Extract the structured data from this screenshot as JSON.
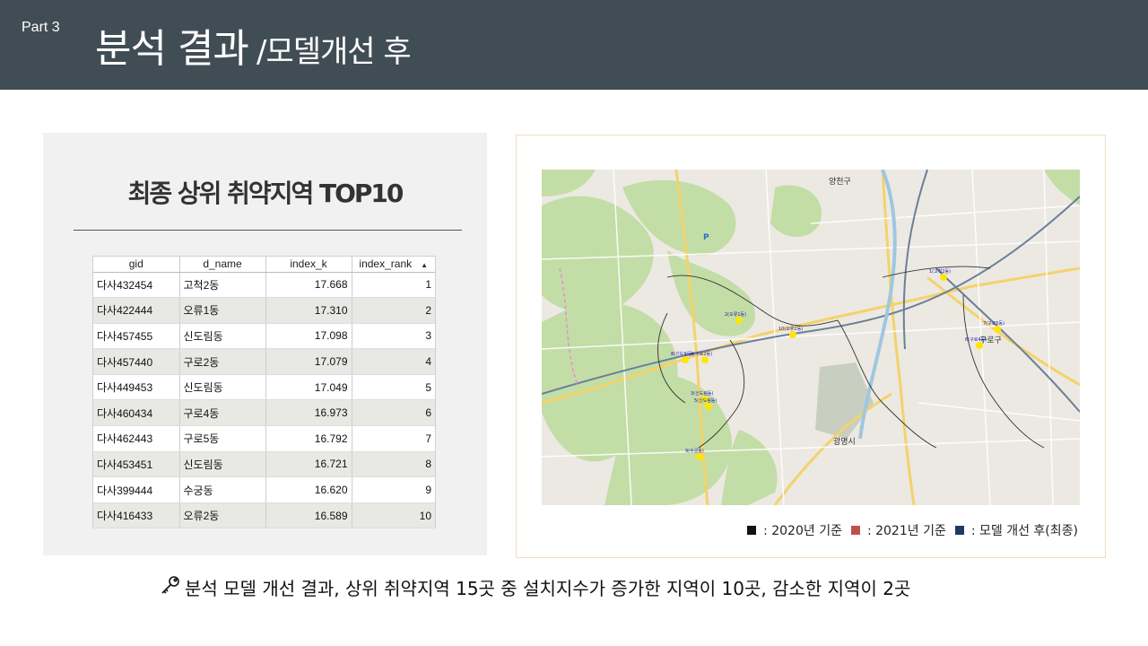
{
  "header": {
    "part_label": "Part 3",
    "title": "분석 결과",
    "subtitle": "/모델개선 후"
  },
  "left_panel": {
    "title": "최종 상위 취약지역 TOP10",
    "table": {
      "columns": [
        "gid",
        "d_name",
        "index_k",
        "index_rank"
      ],
      "sort_indicator": "ascending",
      "rows": [
        [
          "다사432454",
          "고척2동",
          "17.668",
          "1"
        ],
        [
          "다사422444",
          "오류1동",
          "17.310",
          "2"
        ],
        [
          "다사457455",
          "신도림동",
          "17.098",
          "3"
        ],
        [
          "다사457440",
          "구로2동",
          "17.079",
          "4"
        ],
        [
          "다사449453",
          "신도림동",
          "17.049",
          "5"
        ],
        [
          "다사460434",
          "구로4동",
          "16.973",
          "6"
        ],
        [
          "다사462443",
          "구로5동",
          "16.792",
          "7"
        ],
        [
          "다사453451",
          "신도림동",
          "16.721",
          "8"
        ],
        [
          "다사399444",
          "수궁동",
          "16.620",
          "9"
        ],
        [
          "다사416433",
          "오류2동",
          "16.589",
          "10"
        ]
      ]
    }
  },
  "map": {
    "labels": [
      {
        "text": "양천구"
      },
      {
        "text": "광명시"
      },
      {
        "text": "구로구"
      },
      {
        "text": "P"
      }
    ],
    "markers": [
      {
        "text": "1(고척2동)",
        "color": "#ffe600"
      },
      {
        "text": "2(오류1동)",
        "color": "#ffe600"
      },
      {
        "text": "3(신도림동)",
        "color": "#ffe600"
      },
      {
        "text": "4(구로2동)",
        "color": "#ffe600"
      },
      {
        "text": "5(신도림동)",
        "color": "#ffe600"
      },
      {
        "text": "6(구로4동)",
        "color": "#ffe600"
      },
      {
        "text": "7(구로5동)",
        "color": "#ffe600"
      },
      {
        "text": "8(신도림동)",
        "color": "#ffe600"
      },
      {
        "text": "9(수궁동)",
        "color": "#ffe600"
      },
      {
        "text": "10(오류2동)",
        "color": "#ffe600"
      }
    ]
  },
  "legend": {
    "items": [
      {
        "label": ": 2020년 기준",
        "color": "#111111"
      },
      {
        "label": ": 2021년 기준",
        "color": "#c0504d"
      },
      {
        "label": ": 모델 개선 후(최종)",
        "color": "#1f3a5f"
      }
    ]
  },
  "footer": {
    "icon": "key-icon",
    "note": "분석 모델 개선 결과, 상위 취약지역 15곳 중 설치지수가 증가한 지역이 10곳, 감소한 지역이 2곳"
  }
}
